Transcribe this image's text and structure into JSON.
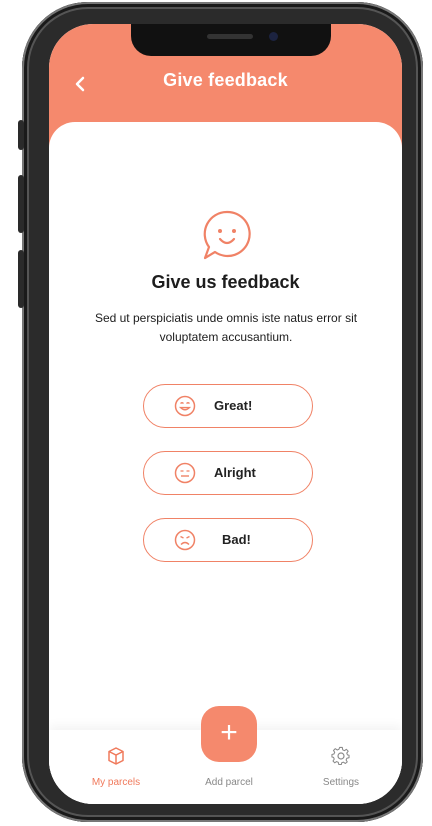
{
  "header": {
    "back_glyph": "‹",
    "title": "Give feedback",
    "color": "#f5896d"
  },
  "feedback": {
    "icon": "smiley-speech-bubble-icon",
    "title": "Give us feedback",
    "description": "Sed ut perspiciatis unde omnis iste natus error sit voluptatem accusantium."
  },
  "options": [
    {
      "label": "Great!",
      "icon": "happy-face-icon"
    },
    {
      "label": "Alright",
      "icon": "neutral-face-icon"
    },
    {
      "label": "Bad!",
      "icon": "sad-face-icon"
    }
  ],
  "tabbar": {
    "items": [
      {
        "label": "My parcels",
        "icon": "parcel-box-icon",
        "active": true
      },
      {
        "label": "Add parcel",
        "icon": "plus-icon",
        "active": false
      },
      {
        "label": "Settings",
        "icon": "gear-icon",
        "active": false
      }
    ],
    "fab_glyph": "+"
  },
  "accent_color": "#f08266"
}
